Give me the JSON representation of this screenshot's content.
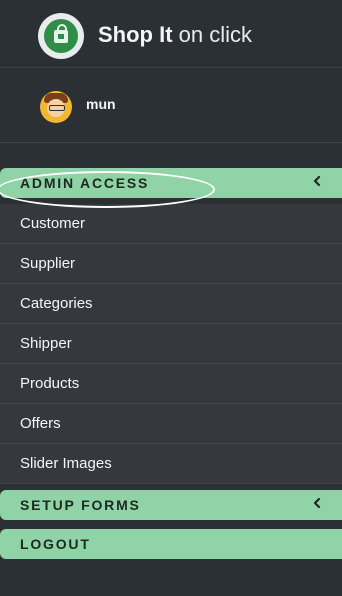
{
  "brand": {
    "name_bold": "Shop It",
    "name_light": "on click"
  },
  "user": {
    "name": "mun"
  },
  "sidebar": {
    "sections": [
      {
        "label": "ADMIN ACCESS",
        "chevron": "chevron-left-icon",
        "items": [
          {
            "label": "Customer"
          },
          {
            "label": "Supplier"
          },
          {
            "label": "Categories"
          },
          {
            "label": "Shipper"
          },
          {
            "label": "Products"
          },
          {
            "label": "Offers"
          },
          {
            "label": "Slider Images"
          }
        ]
      },
      {
        "label": "SETUP FORMS",
        "chevron": "chevron-left-icon"
      },
      {
        "label": "LOGOUT"
      }
    ]
  },
  "colors": {
    "sidebar_bg": "#2b3034",
    "accent": "#8fd3a6",
    "submenu_bg": "#35393d",
    "text": "#f4f6f7"
  }
}
